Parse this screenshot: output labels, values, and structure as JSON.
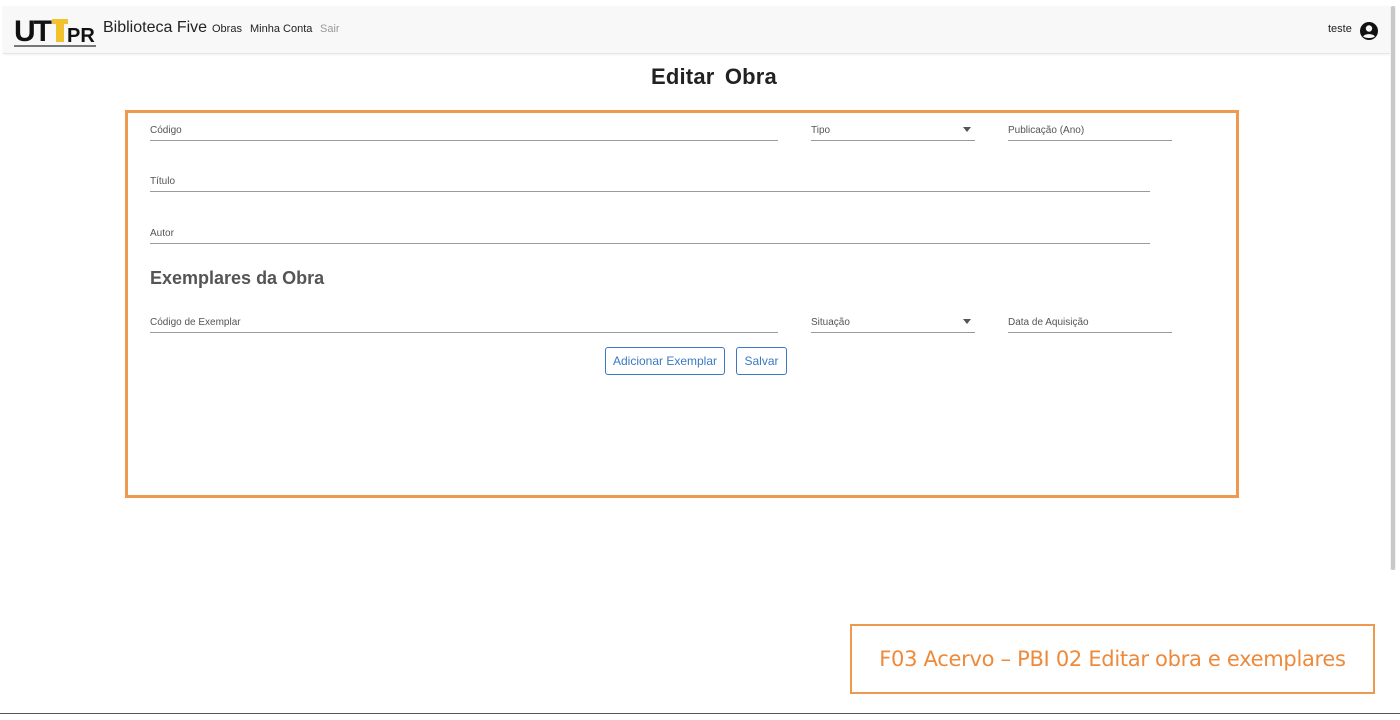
{
  "navbar": {
    "logo_alt": "UTFPR",
    "brand": "Biblioteca Five",
    "links": [
      "Obras",
      "Minha Conta",
      "Sair"
    ],
    "user": "teste"
  },
  "page_title": "Editar  Obra",
  "form": {
    "codigo_label": "Código",
    "tipo_label": "Tipo",
    "publicacao_label": "Publicação (Ano)",
    "titulo_label": "Título",
    "autor_label": "Autor",
    "exemplares_title": "Exemplares da Obra",
    "codigo_exemplar_label": "Código de Exemplar",
    "situacao_label": "Situação",
    "data_aquisicao_label": "Data de Aquisição"
  },
  "buttons": {
    "add_exemplar": "Adicionar Exemplar",
    "save": "Salvar"
  },
  "caption": "F03 Acervo – PBI 02 Editar obra e exemplares",
  "colors": {
    "accent_orange": "#ed9a4f",
    "button_blue": "#3a78c4",
    "navbar_bg": "#f8f8f8"
  }
}
